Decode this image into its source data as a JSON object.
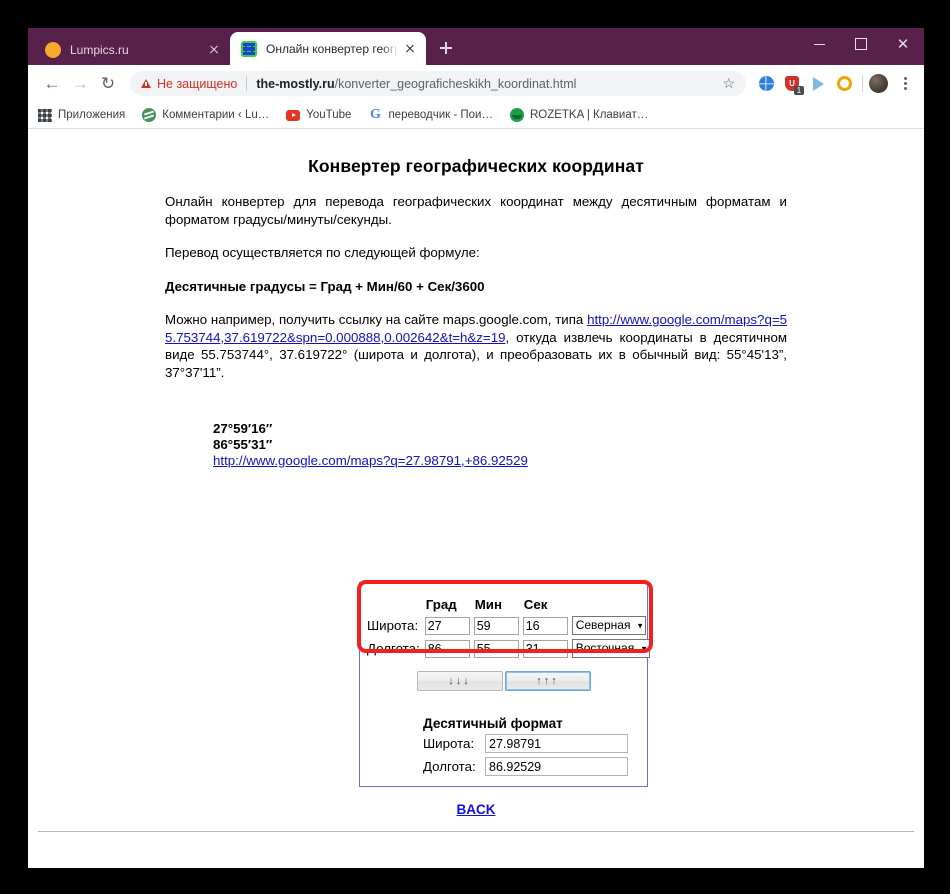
{
  "window": {
    "controls": {
      "minimize": "–",
      "maximize": "□",
      "close": "✕"
    }
  },
  "tabs": [
    {
      "title": "Lumpics.ru",
      "favicon": "orange-circle-icon",
      "active": false,
      "close": "✕"
    },
    {
      "title": "Онлайн конвертер географичес",
      "favicon": "green-grid-icon",
      "active": true,
      "close": "✕"
    }
  ],
  "newtab_label": "+",
  "toolbar": {
    "back": "←",
    "forward": "→",
    "reload": "↻",
    "security_label": "Не защищено",
    "url_domain": "the-mostly.ru",
    "url_path": "/konverter_geograficheskikh_koordinat.html",
    "star": "☆",
    "extension_badge": "1",
    "shield_glyph": "U"
  },
  "bookmarks": [
    {
      "label": "Приложения",
      "icon": "apps-grid-icon"
    },
    {
      "label": "Комментарии ‹ Lu…",
      "icon": "globe-icon"
    },
    {
      "label": "YouTube",
      "icon": "youtube-icon"
    },
    {
      "label": "переводчик - Пои…",
      "icon": "google-g-icon"
    },
    {
      "label": "ROZETKA | Клавиат…",
      "icon": "rozetka-icon"
    }
  ],
  "page": {
    "title": "Конвертер географических координат",
    "intro": "Онлайн конвертер для перевода географических координат между десятичным форматам и форматом градусы/минуты/секунды.",
    "formula_lead": "Перевод осуществляется по следующей формуле:",
    "formula": "Десятичные градусы = Град + Мин/60 + Сек/3600",
    "example_pre": "Можно например, получить ссылку на сайте maps.google.com, типа ",
    "example_link": "http://www.google.com/maps?q=55.753744,37.619722&spn=0.000888,0.002642&t=h&z=19",
    "example_post": ", откуда извлечь координаты в десятичном виде 55.753744°, 37.619722° (широта и долгота), и преобразовать их в обычный вид: 55°45'13”, 37°37'11”."
  },
  "result": {
    "latitude_dms": "27°59′16″",
    "longitude_dms": "86°55′31″",
    "map_link": "http://www.google.com/maps?q=27.98791,+86.92529"
  },
  "converter": {
    "headers": {
      "deg": "Град",
      "min": "Мин",
      "sec": "Сек"
    },
    "rows": [
      {
        "label": "Широта:",
        "deg": "27",
        "min": "59",
        "sec": "16",
        "hemisphere": "Северная"
      },
      {
        "label": "Долгота:",
        "deg": "86",
        "min": "55",
        "sec": "31",
        "hemisphere": "Восточная"
      }
    ],
    "buttons": {
      "down": "↓↓↓",
      "up": "↑↑↑"
    },
    "decimal": {
      "heading": "Десятичный формат",
      "lat_label": "Широта:",
      "lat_value": "27.98791",
      "lon_label": "Долгота:",
      "lon_value": "86.92529"
    }
  },
  "back_link": "BACK",
  "colors": {
    "window_chrome": "#57214b",
    "highlight": "#f42020",
    "form_border": "#6d6ddd",
    "link": "#1010cf",
    "insecure": "#d93025"
  }
}
